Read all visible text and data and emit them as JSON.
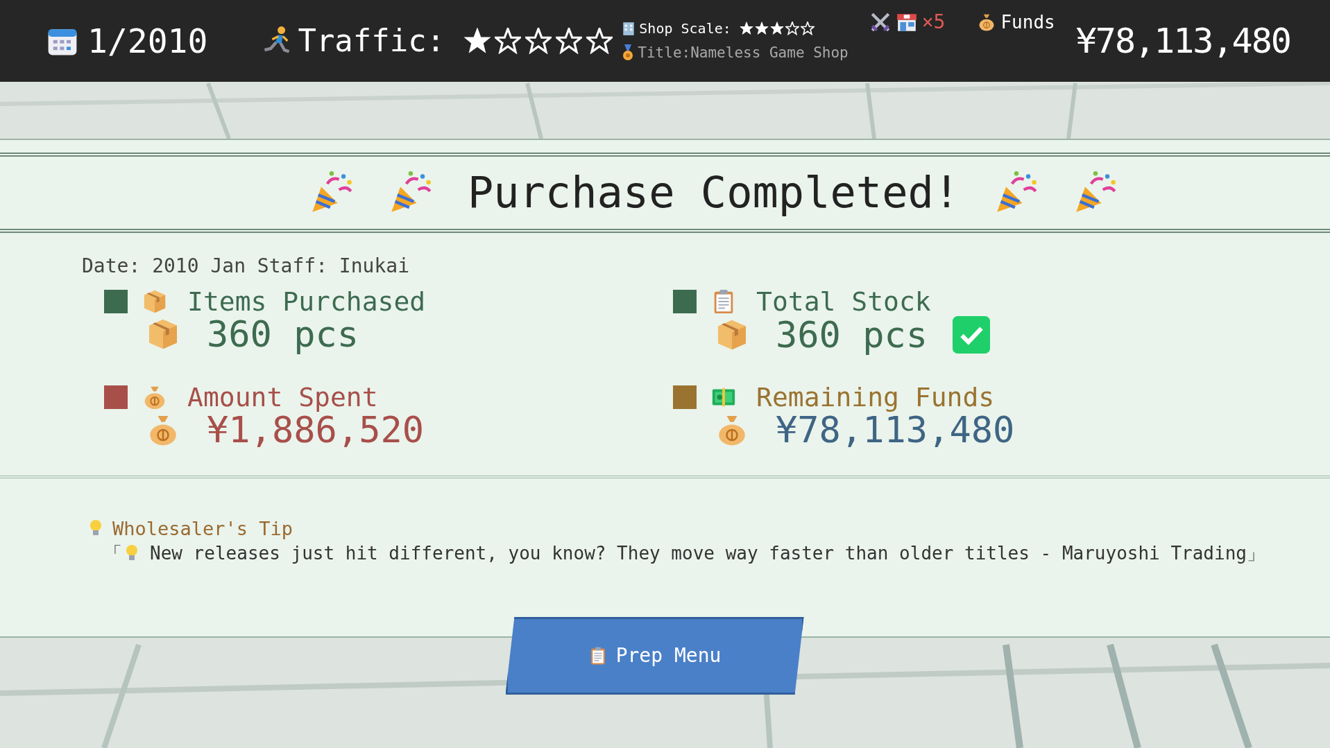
{
  "top_bar": {
    "date": "1/2010",
    "traffic": {
      "label": "Traffic:",
      "stars": 1
    },
    "shop_scale": {
      "label": "Shop Scale:",
      "stars": 3
    },
    "title": "Title:Nameless Game Shop",
    "store_count": "×5",
    "funds_label": "Funds",
    "funds": "¥78,113,480"
  },
  "dialog": {
    "title": "Purchase Completed!",
    "meta": "Date: 2010 Jan Staff: Inukai",
    "stats": [
      {
        "kind": "items",
        "label": "Items Purchased",
        "value": "360 pcs",
        "color": "#3d6b50",
        "checked": false
      },
      {
        "kind": "stock",
        "label": "Total Stock",
        "value": "360 pcs",
        "color": "#3d6b50",
        "checked": true
      },
      {
        "kind": "spent",
        "label": "Amount Spent",
        "value": "¥1,886,520",
        "color": "#a84f4a",
        "checked": false
      },
      {
        "kind": "remaining",
        "label": "Remaining Funds",
        "value": "¥78,113,480",
        "color": "#9a7330",
        "checked": false
      }
    ],
    "tip": {
      "label": "Wholesaler's Tip",
      "open_mark": "「",
      "text": "New releases just hit different, you know? They move way faster than older titles - Maruyoshi Trading」"
    },
    "button": "Prep Menu"
  }
}
